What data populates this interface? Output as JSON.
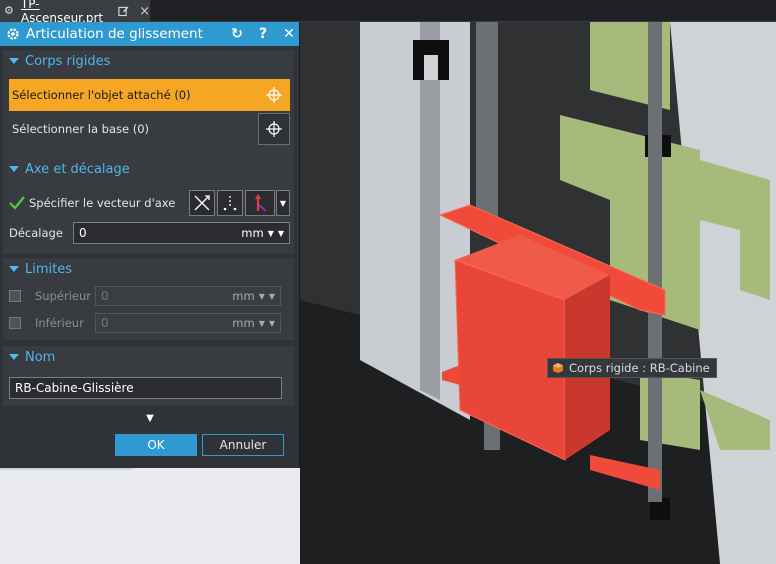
{
  "tab": {
    "title": "TP-Ascenseur.prt",
    "close": "×"
  },
  "dialog": {
    "title": "Articulation de glissement",
    "buttons": {
      "reset": "↻",
      "help": "?",
      "close": "✕"
    },
    "sections": {
      "rigid_bodies": {
        "header": "Corps rigides",
        "attached": "Sélectionner l'objet attaché (0)",
        "base": "Sélectionner la base (0)"
      },
      "axis": {
        "header": "Axe et décalage",
        "vector_label": "Spécifier le vecteur d'axe",
        "offset_label": "Décalage",
        "offset_value": "0",
        "offset_unit": "mm"
      },
      "limits": {
        "header": "Limites",
        "upper_label": "Supérieur",
        "upper_value": "0",
        "upper_unit": "mm",
        "lower_label": "Inférieur",
        "lower_value": "0",
        "lower_unit": "mm"
      },
      "name": {
        "header": "Nom",
        "value": "RB-Cabine-Glissière"
      }
    },
    "ok": "OK",
    "cancel": "Annuler"
  },
  "tooltip": {
    "text": "Corps rigide : RB-Cabine"
  },
  "axis_label": "Z",
  "colors": {
    "accent": "#2f9ad0",
    "selected": "#f5a623",
    "highlight": "#f04030",
    "part_green": "#a6bb7b"
  }
}
